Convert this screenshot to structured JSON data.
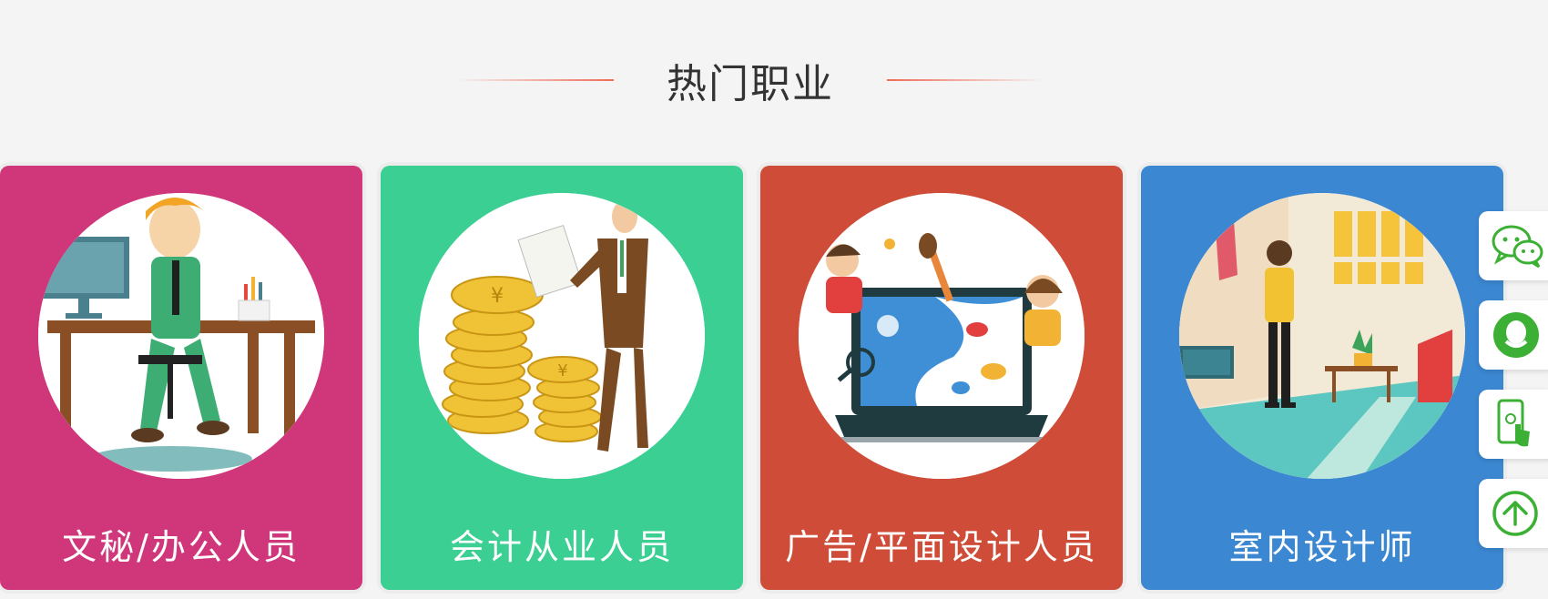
{
  "section": {
    "title": "热门职业"
  },
  "cards": [
    {
      "label": "文秘/办公人员",
      "color": "#d0377a",
      "illustration": "office-worker-illustration"
    },
    {
      "label": "会计从业人员",
      "color": "#3ccf93",
      "illustration": "accountant-coins-illustration"
    },
    {
      "label": "广告/平面设计人员",
      "color": "#cf4d38",
      "illustration": "graphic-design-laptop-illustration"
    },
    {
      "label": "室内设计师",
      "color": "#3b87d1",
      "illustration": "interior-room-illustration"
    }
  ],
  "side_toolbar": {
    "accent": "#3cb034",
    "buttons": [
      "wechat-icon",
      "qq-icon",
      "mobile-icon",
      "back-to-top-icon"
    ]
  }
}
